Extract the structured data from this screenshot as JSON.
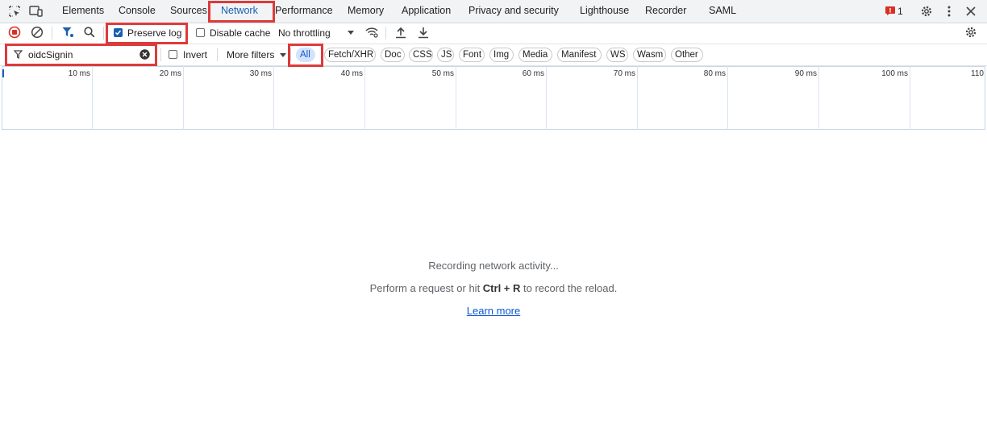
{
  "tabs": [
    "Elements",
    "Console",
    "Sources",
    "Network",
    "Performance",
    "Memory",
    "Application",
    "Privacy and security",
    "Lighthouse",
    "Recorder",
    "SAML"
  ],
  "active_tab": "Network",
  "issues_count": "1",
  "toolbar": {
    "preserve_log_label": "Preserve log",
    "disable_cache_label": "Disable cache",
    "throttling_value": "No throttling"
  },
  "filter": {
    "value": "oidcSignin",
    "invert_label": "Invert",
    "more_filters_label": "More filters",
    "types": [
      "All",
      "Fetch/XHR",
      "Doc",
      "CSS",
      "JS",
      "Font",
      "Img",
      "Media",
      "Manifest",
      "WS",
      "Wasm",
      "Other"
    ],
    "selected_type": "All"
  },
  "timeline_ticks": [
    "10 ms",
    "20 ms",
    "30 ms",
    "40 ms",
    "50 ms",
    "60 ms",
    "70 ms",
    "80 ms",
    "90 ms",
    "100 ms",
    "110"
  ],
  "empty_state": {
    "line1": "Recording network activity...",
    "line2_pre": "Perform a request or hit ",
    "line2_key": "Ctrl + R",
    "line2_post": " to record the reload.",
    "learn_more": "Learn more"
  },
  "colors": {
    "highlight": "#dc3b3b",
    "active_tab": "#1a5fb4",
    "record_red": "#d93025"
  }
}
